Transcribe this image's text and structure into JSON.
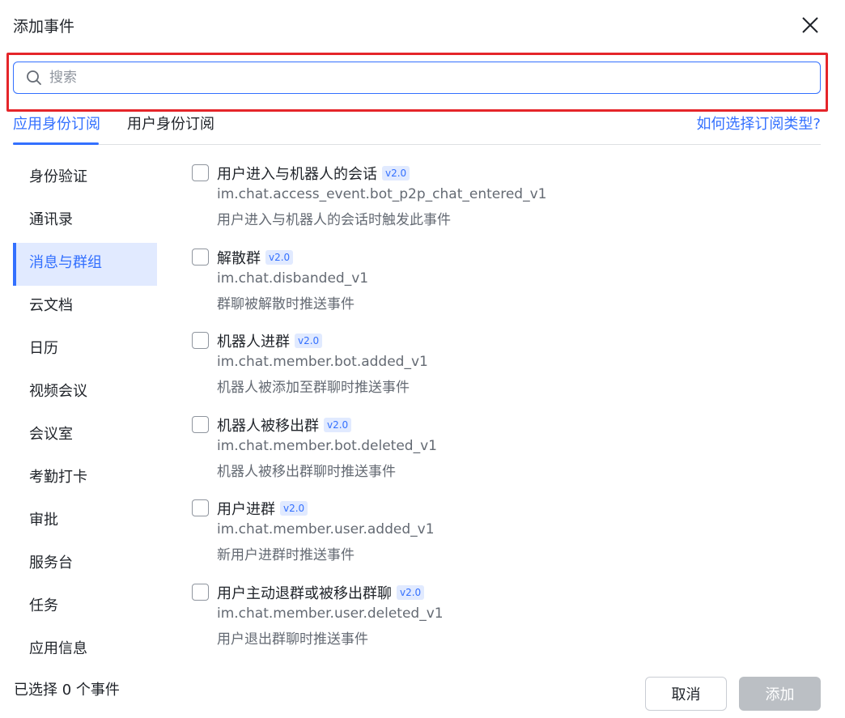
{
  "dialog": {
    "title": "添加事件"
  },
  "search": {
    "placeholder": "搜索",
    "value": ""
  },
  "tabs": [
    {
      "label": "应用身份订阅",
      "active": true
    },
    {
      "label": "用户身份订阅",
      "active": false
    }
  ],
  "help_link": "如何选择订阅类型?",
  "sidebar": {
    "items": [
      {
        "label": "身份验证"
      },
      {
        "label": "通讯录"
      },
      {
        "label": "消息与群组",
        "active": true
      },
      {
        "label": "云文档"
      },
      {
        "label": "日历"
      },
      {
        "label": "视频会议"
      },
      {
        "label": "会议室"
      },
      {
        "label": "考勤打卡"
      },
      {
        "label": "审批"
      },
      {
        "label": "服务台"
      },
      {
        "label": "任务"
      },
      {
        "label": "应用信息"
      }
    ]
  },
  "events": [
    {
      "title": "用户进入与机器人的会话",
      "version": "v2.0",
      "key": "im.chat.access_event.bot_p2p_chat_entered_v1",
      "desc": "用户进入与机器人的会话时触发此事件",
      "checked": false
    },
    {
      "title": "解散群",
      "version": "v2.0",
      "key": "im.chat.disbanded_v1",
      "desc": "群聊被解散时推送事件",
      "checked": false
    },
    {
      "title": "机器人进群",
      "version": "v2.0",
      "key": "im.chat.member.bot.added_v1",
      "desc": "机器人被添加至群聊时推送事件",
      "checked": false
    },
    {
      "title": "机器人被移出群",
      "version": "v2.0",
      "key": "im.chat.member.bot.deleted_v1",
      "desc": "机器人被移出群聊时推送事件",
      "checked": false
    },
    {
      "title": "用户进群",
      "version": "v2.0",
      "key": "im.chat.member.user.added_v1",
      "desc": "新用户进群时推送事件",
      "checked": false
    },
    {
      "title": "用户主动退群或被移出群聊",
      "version": "v2.0",
      "key": "im.chat.member.user.deleted_v1",
      "desc": "用户退出群聊时推送事件",
      "checked": false
    }
  ],
  "footer": {
    "selected_count": "已选择 0 个事件",
    "cancel_label": "取消",
    "add_label": "添加"
  },
  "colors": {
    "accent": "#3370ff",
    "highlight": "#e5252a",
    "disabled": "#bbbfc4"
  }
}
